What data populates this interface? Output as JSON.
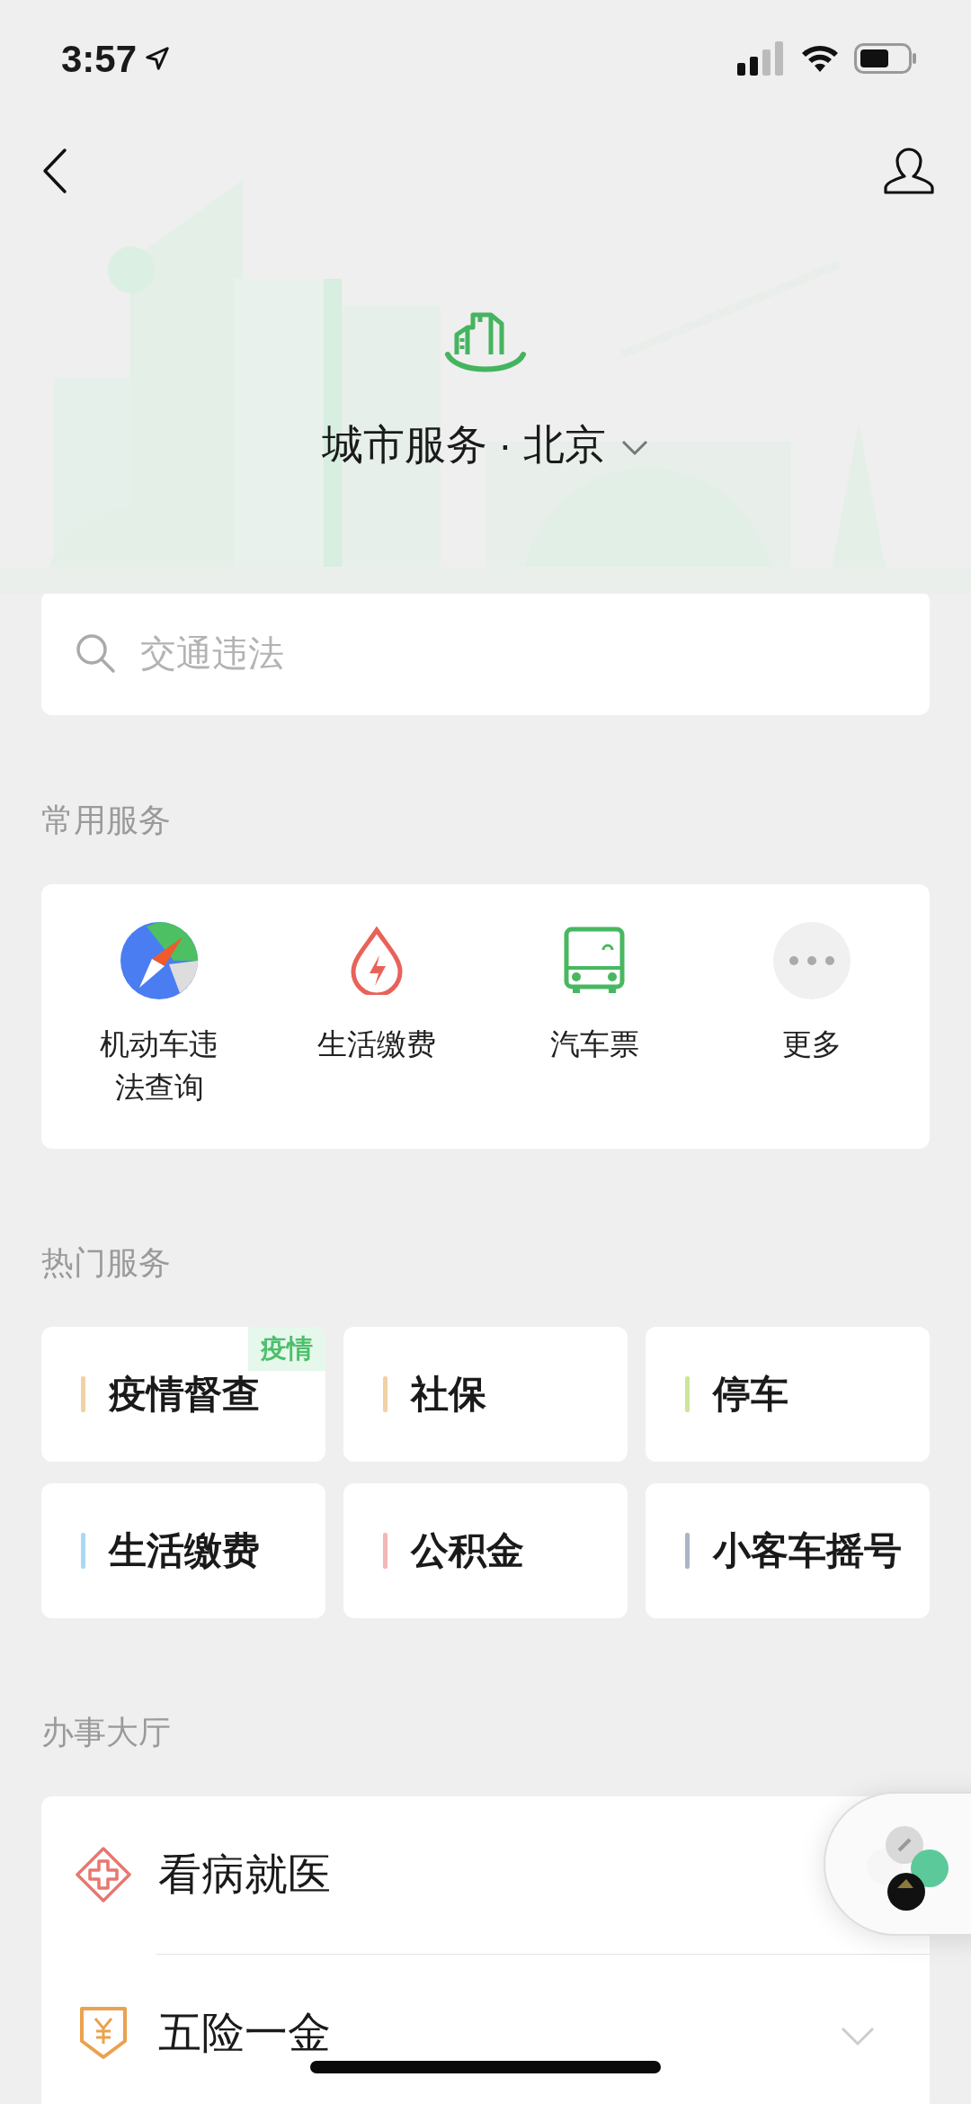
{
  "status_bar": {
    "time": "3:57"
  },
  "header": {
    "title": "城市服务 · 北京"
  },
  "search": {
    "placeholder": "交通违法"
  },
  "common_services": {
    "title": "常用服务",
    "items": [
      {
        "label": "机动车违法查询",
        "kind": "compass"
      },
      {
        "label": "生活缴费",
        "kind": "drop"
      },
      {
        "label": "汽车票",
        "kind": "bus"
      },
      {
        "label": "更多",
        "kind": "more"
      }
    ]
  },
  "hot_services": {
    "title": "热门服务",
    "items": [
      {
        "label": "疫情督查",
        "color": "#f2d1a4",
        "tag": "疫情"
      },
      {
        "label": "社保",
        "color": "#f2d1a4"
      },
      {
        "label": "停车",
        "color": "#cbe59c"
      },
      {
        "label": "生活缴费",
        "color": "#a9d9f2"
      },
      {
        "label": "公积金",
        "color": "#f4b6b6"
      },
      {
        "label": "小客车摇号",
        "color": "#aab5c6"
      }
    ]
  },
  "service_hall": {
    "title": "办事大厅",
    "items": [
      {
        "label": "看病就医",
        "kind": "medical",
        "chevron": false
      },
      {
        "label": "五险一金",
        "kind": "insurance",
        "chevron": true
      }
    ]
  }
}
